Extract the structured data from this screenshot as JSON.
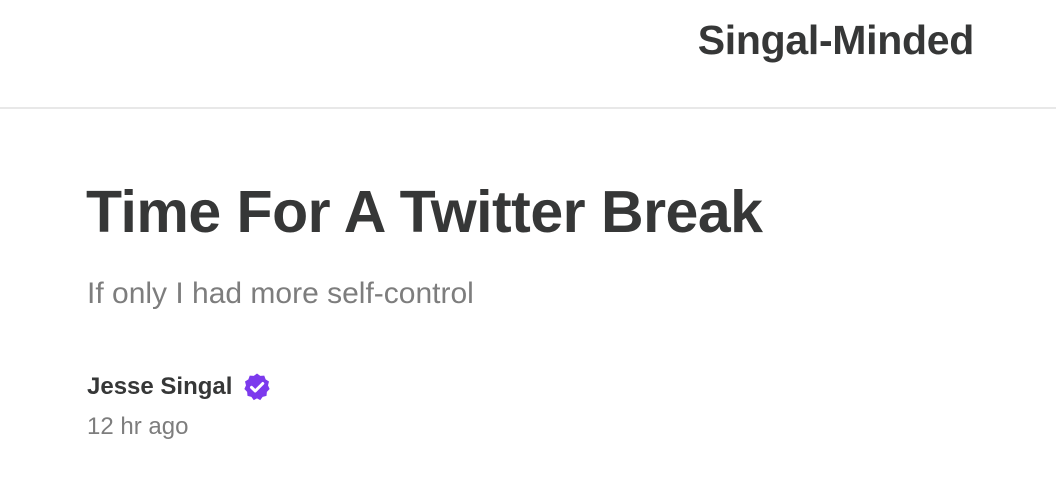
{
  "header": {
    "publication_name": "Singal-Minded"
  },
  "post": {
    "title": "Time For A Twitter Break",
    "subtitle": "If only I had more self-control",
    "author": {
      "name": "Jesse Singal",
      "badge_icon": "verified-badge-icon",
      "badge_color": "#7c3aed"
    },
    "timestamp": "12 hr ago"
  },
  "colors": {
    "text_primary": "#363737",
    "text_secondary": "#7d7d7d",
    "divider": "#e8e8e8",
    "background": "#ffffff"
  }
}
